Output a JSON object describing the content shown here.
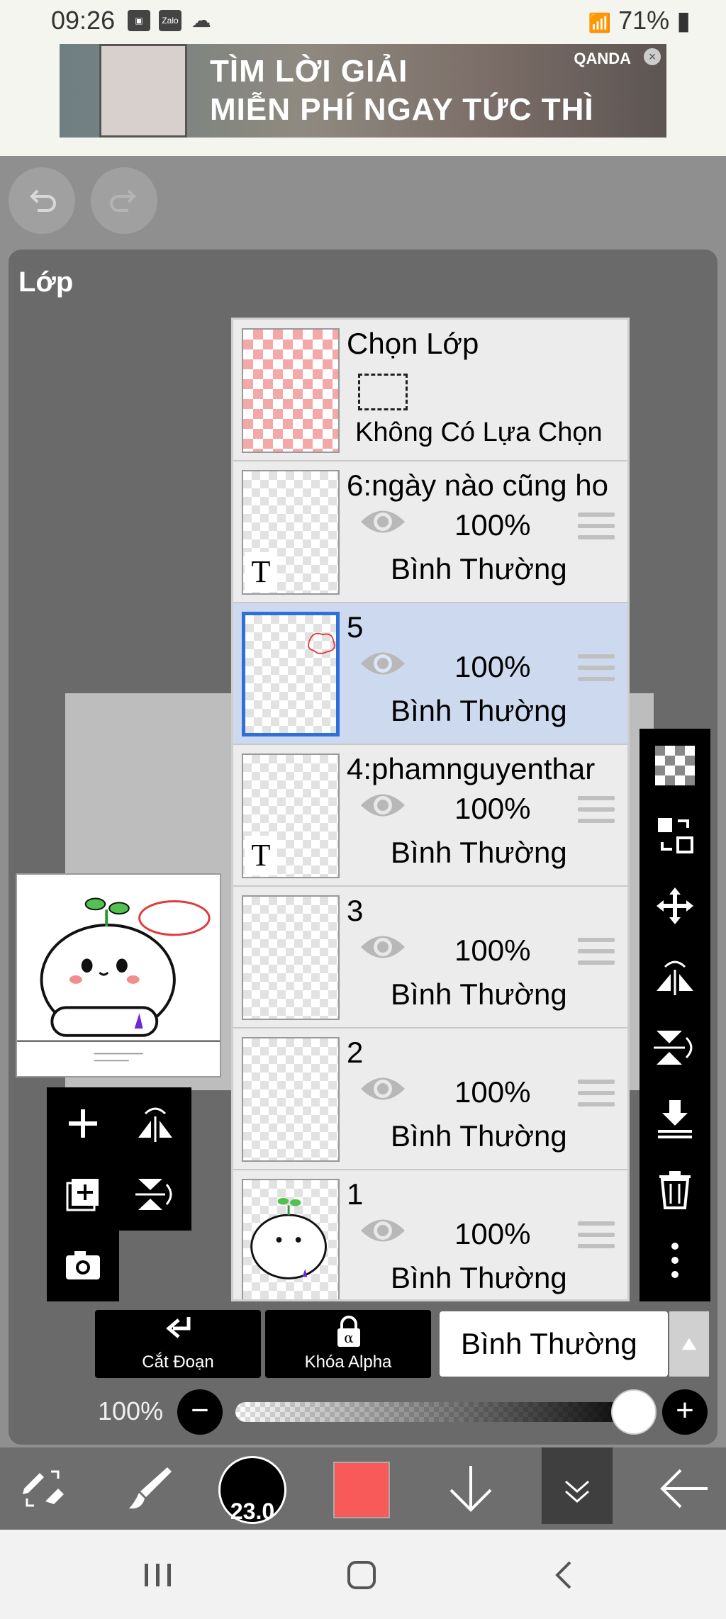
{
  "status_bar": {
    "time": "09:26",
    "notif_icons": [
      "gallery-icon",
      "zalo-icon",
      "cloud-icon"
    ],
    "zalo_label": "Zalo",
    "battery": "71%"
  },
  "ad": {
    "line1": "TÌM LỜI GIẢI",
    "line2": "MIỄN PHÍ NGAY TỨC THÌ",
    "brand": "QANDA"
  },
  "panel": {
    "title": "Lớp"
  },
  "selection_layer": {
    "title": "Chọn Lớp",
    "status": "Không Có Lựa Chọn"
  },
  "layers": [
    {
      "name": "6:ngày nào cũng ho",
      "opacity": "100%",
      "blend": "Bình Thường",
      "type": "text",
      "badge": "T",
      "selected": false
    },
    {
      "name": "5",
      "opacity": "100%",
      "blend": "Bình Thường",
      "type": "raster",
      "selected": true
    },
    {
      "name": "4:phamnguyenthar",
      "opacity": "100%",
      "blend": "Bình Thường",
      "type": "text",
      "badge": "T",
      "selected": false
    },
    {
      "name": "3",
      "opacity": "100%",
      "blend": "Bình Thường",
      "type": "raster",
      "selected": false
    },
    {
      "name": "2",
      "opacity": "100%",
      "blend": "Bình Thường",
      "type": "raster",
      "selected": false
    },
    {
      "name": "1",
      "opacity": "100%",
      "blend": "Bình Thường",
      "type": "raster",
      "selected": false
    }
  ],
  "controls": {
    "clip_label": "Cắt Đoạn",
    "alpha_lock_label": "Khóa Alpha",
    "blend_mode": "Bình Thường",
    "opacity_label": "100%",
    "opacity_value": 1.0
  },
  "bottom_bar": {
    "brush_size": "23.0",
    "color": "#f85a5a"
  },
  "colors": {
    "selected_row": "#cdd9ef",
    "selected_border": "#2f6fd6",
    "toolbar_bg": "#000000",
    "panel_bg": "#6a6a6a"
  }
}
